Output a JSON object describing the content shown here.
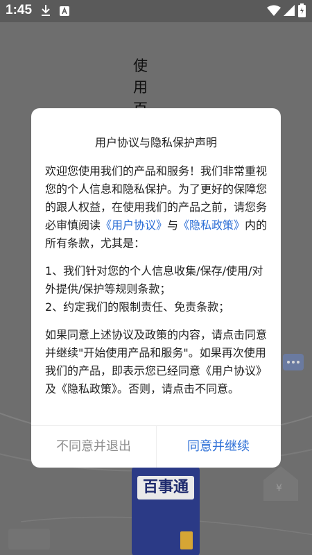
{
  "status_bar": {
    "time": "1:45",
    "icons": [
      "download-icon",
      "app-notification-icon",
      "wifi-icon",
      "signal-icon",
      "battery-icon"
    ]
  },
  "background": {
    "vertical_title": "使用百",
    "product_label": "百事通",
    "house_symbol": "¥"
  },
  "dialog": {
    "title": "用户协议与隐私保护声明",
    "intro": {
      "text1": "欢迎您使用我们的产品和服务！我们非常重视您的个人信息和隐私保护。为了更好的保障您的跟人权益，在使用我们的产品之前，请您务必审慎阅读",
      "link1": "《用户协议》",
      "text2": "与",
      "link2": "《隐私政策》",
      "text3": "内的所有条款，尤其是："
    },
    "terms": [
      "1、我们针对您的个人信息收集/保存/使用/对外提供/保护等规则条款；",
      "2、约定我们的限制责任、免责条款；"
    ],
    "closing": "如果同意上述协议及政策的内容，请点击同意并继续\"开始使用产品和服务\"。如果再次使用我们的产品，即表示您已经同意《用户协议》及《隐私政策》。否则，请点击不同意。",
    "disagree_label": "不同意并退出",
    "agree_label": "同意并继续"
  },
  "colors": {
    "link": "#2a6dd6",
    "disagree_text": "#8d8d8d",
    "overlay": "#6e6e6e"
  }
}
